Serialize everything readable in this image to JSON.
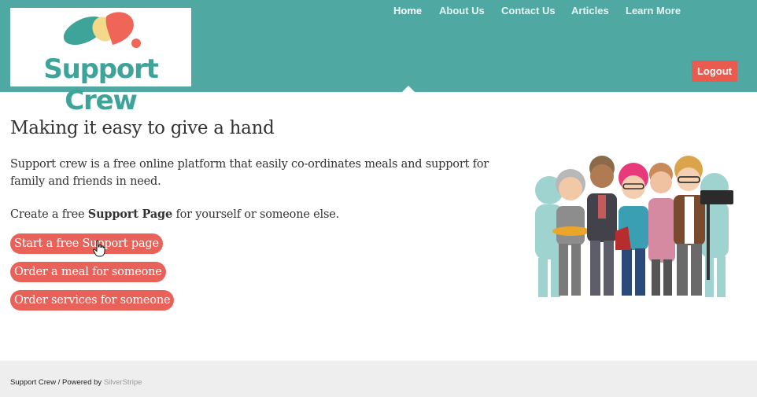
{
  "brand": {
    "name": "Support Crew",
    "colors": {
      "header": "#4fa9a2",
      "accent": "#e8625a",
      "logo_text": "#3ea49a"
    }
  },
  "nav": {
    "items": [
      {
        "label": "Home",
        "active": true
      },
      {
        "label": "About Us",
        "active": false
      },
      {
        "label": "Contact Us",
        "active": false
      },
      {
        "label": "Articles",
        "active": false
      },
      {
        "label": "Learn More",
        "active": false
      }
    ],
    "logout_label": "Logout"
  },
  "main": {
    "title": "Making it easy to give a hand",
    "intro": "Support crew is a free online platform that easily co-ordinates meals and support for family and friends in need.",
    "create_prefix": "Create a free ",
    "create_bold": "Support Page",
    "create_suffix": " for yourself or someone else.",
    "buttons": {
      "start": "Start a free Support page",
      "meal": "Order a meal for someone",
      "services": "Order services for someone"
    }
  },
  "footer": {
    "text": "Support Crew / Powered by ",
    "link": "SilverStripe"
  }
}
